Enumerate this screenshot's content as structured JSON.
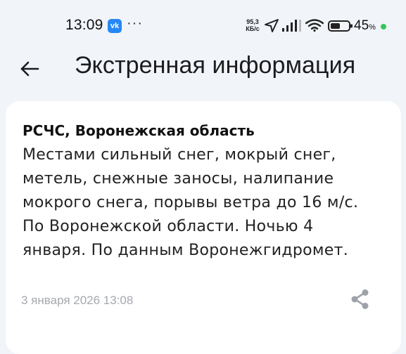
{
  "status_bar": {
    "time": "13:09",
    "vk_badge": "vk",
    "more_dots": "···",
    "speed_value": "95,3",
    "speed_unit": "КБ/с",
    "battery_value": "45",
    "battery_unit": "%",
    "battery_dot_color": "#34c759",
    "icons": [
      "vk-icon",
      "location-arrow-icon",
      "cellular-signal-icon",
      "wifi-icon",
      "battery-icon"
    ]
  },
  "app_bar": {
    "back_icon": "arrow-left-icon",
    "title": "Экстренная информация"
  },
  "alert": {
    "source": "РСЧС, Воронежская область",
    "message_lines": [
      "Местами сильный снег, мокрый снег,",
      "метель, снежные заносы, налипание",
      "мокрого снега, порывы ветра до 16 м/с.",
      "По Воронежской области. Ночью 4",
      "января. По данным Воронежгидромет."
    ],
    "date": "3 января 2026 13:08",
    "share_icon": "share-icon"
  },
  "colors": {
    "background": "#f1f4f9",
    "card": "#ffffff",
    "date_text": "#a5a8ae",
    "share_icon": "#9ea2a8"
  }
}
